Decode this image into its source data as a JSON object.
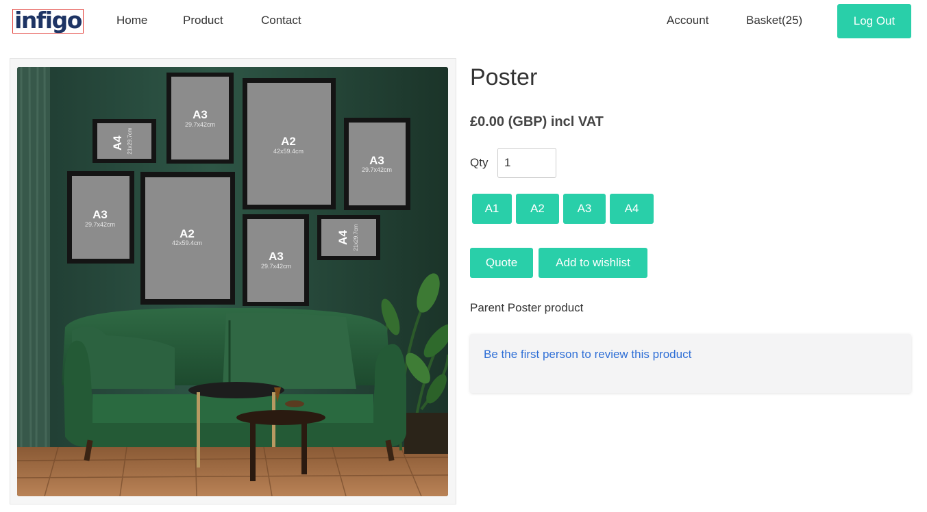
{
  "header": {
    "logo_text": "infigo",
    "nav": [
      {
        "label": "Home"
      },
      {
        "label": "Product"
      },
      {
        "label": "Contact"
      }
    ],
    "account_label": "Account",
    "basket_label": "Basket(25)",
    "logout_label": "Log Out"
  },
  "product": {
    "image_icon": "living-room-poster-mockup-image",
    "title": "Poster",
    "price": "£0.00 (GBP) incl VAT",
    "qty_label": "Qty",
    "qty_value": "1",
    "sizes": [
      {
        "label": "A1"
      },
      {
        "label": "A2"
      },
      {
        "label": "A3"
      },
      {
        "label": "A4"
      }
    ],
    "quote_label": "Quote",
    "wishlist_label": "Add to wishlist",
    "description": "Parent Poster product",
    "review_link": "Be the first person to review this product"
  },
  "mockup": {
    "frames": [
      {
        "size": "A4",
        "dims": "21x29.7cm"
      },
      {
        "size": "A3",
        "dims": "29.7x42cm"
      },
      {
        "size": "A2",
        "dims": "42x59.4cm"
      },
      {
        "size": "A3",
        "dims": "29.7x42cm"
      },
      {
        "size": "A3",
        "dims": "29.7x42cm"
      },
      {
        "size": "A2",
        "dims": "42x59.4cm"
      },
      {
        "size": "A3",
        "dims": "29.7x42cm"
      },
      {
        "size": "A4",
        "dims": "21x29.7cm"
      }
    ]
  },
  "colors": {
    "accent": "#29cfa9",
    "link": "#2f6fd6",
    "logo_navy": "#1e3464",
    "logo_border": "#e2403a",
    "wall_green": "#264a3c"
  }
}
